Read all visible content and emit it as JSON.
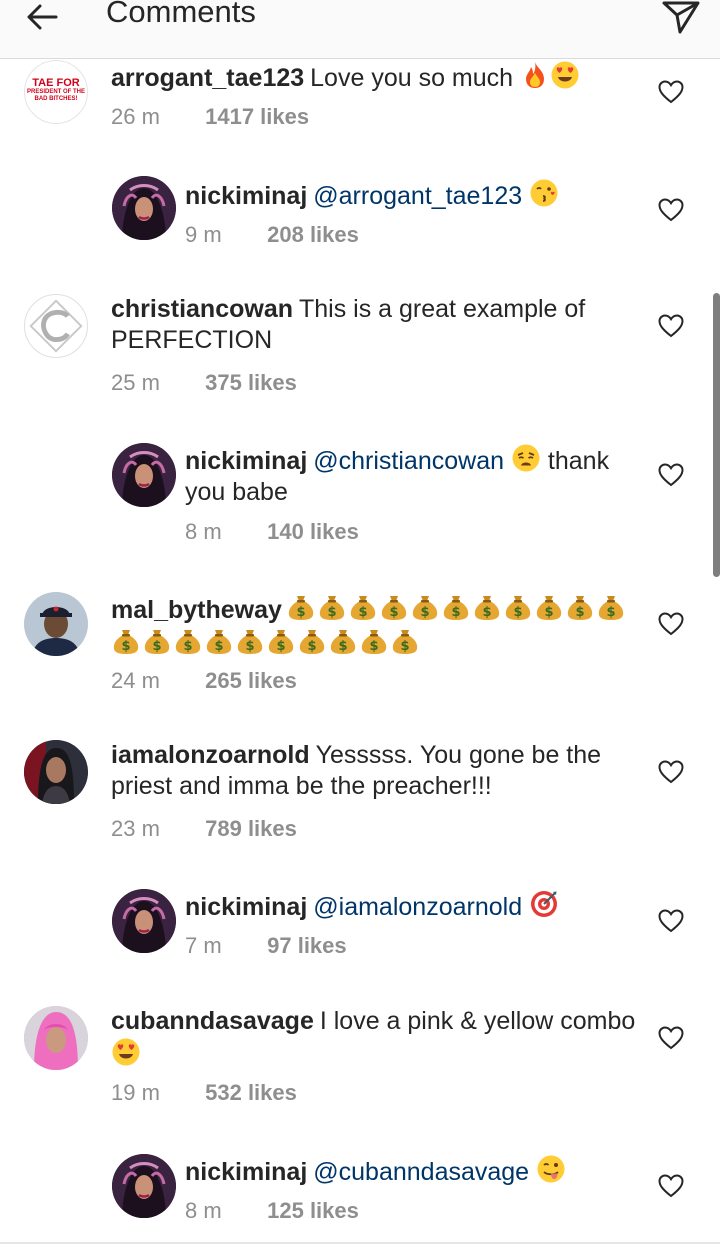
{
  "header": {
    "title": "Comments"
  },
  "colors": {
    "mention": "#003569",
    "meta": "#8e8e8e",
    "text": "#262626"
  },
  "comments": [
    {
      "username": "arrogant_tae123",
      "text": "Love you so much",
      "emojis": [
        "fire",
        "heart-eyes"
      ],
      "time": "26 m",
      "likes": "1417 likes",
      "avatar_text": [
        "TAE FOR",
        "PRESIDENT OF THE",
        "BAD BITCHES!"
      ],
      "reply": false
    },
    {
      "username": "nickiminaj",
      "mention": "@arrogant_tae123",
      "emojis": [
        "kissing-face"
      ],
      "time": "9 m",
      "likes": "208 likes",
      "reply": true
    },
    {
      "username": "christiancowan",
      "text": "This is a great example of PERFECTION",
      "time": "25 m",
      "likes": "375 likes",
      "reply": false
    },
    {
      "username": "nickiminaj",
      "mention": "@christiancowan",
      "text": "thank you babe",
      "emojis": [
        "weary-face"
      ],
      "time": "8 m",
      "likes": "140 likes",
      "reply": true
    },
    {
      "username": "mal_bytheway",
      "emojis": [
        "money-bag x21"
      ],
      "time": "24 m",
      "likes": "265 likes",
      "reply": false
    },
    {
      "username": "iamalonzoarnold",
      "text": "Yesssss. You gone be the priest and imma be the preacher!!!",
      "time": "23 m",
      "likes": "789 likes",
      "reply": false
    },
    {
      "username": "nickiminaj",
      "mention": "@iamalonzoarnold",
      "emojis": [
        "direct-hit"
      ],
      "time": "7 m",
      "likes": "97 likes",
      "reply": true
    },
    {
      "username": "cubanndasavage",
      "text": "I love a pink & yellow combo",
      "emojis": [
        "heart-eyes"
      ],
      "time": "19 m",
      "likes": "532 likes",
      "reply": false
    },
    {
      "username": "nickiminaj",
      "mention": "@cubanndasavage",
      "emojis": [
        "tongue-out"
      ],
      "time": "8 m",
      "likes": "125 likes",
      "reply": true
    }
  ]
}
